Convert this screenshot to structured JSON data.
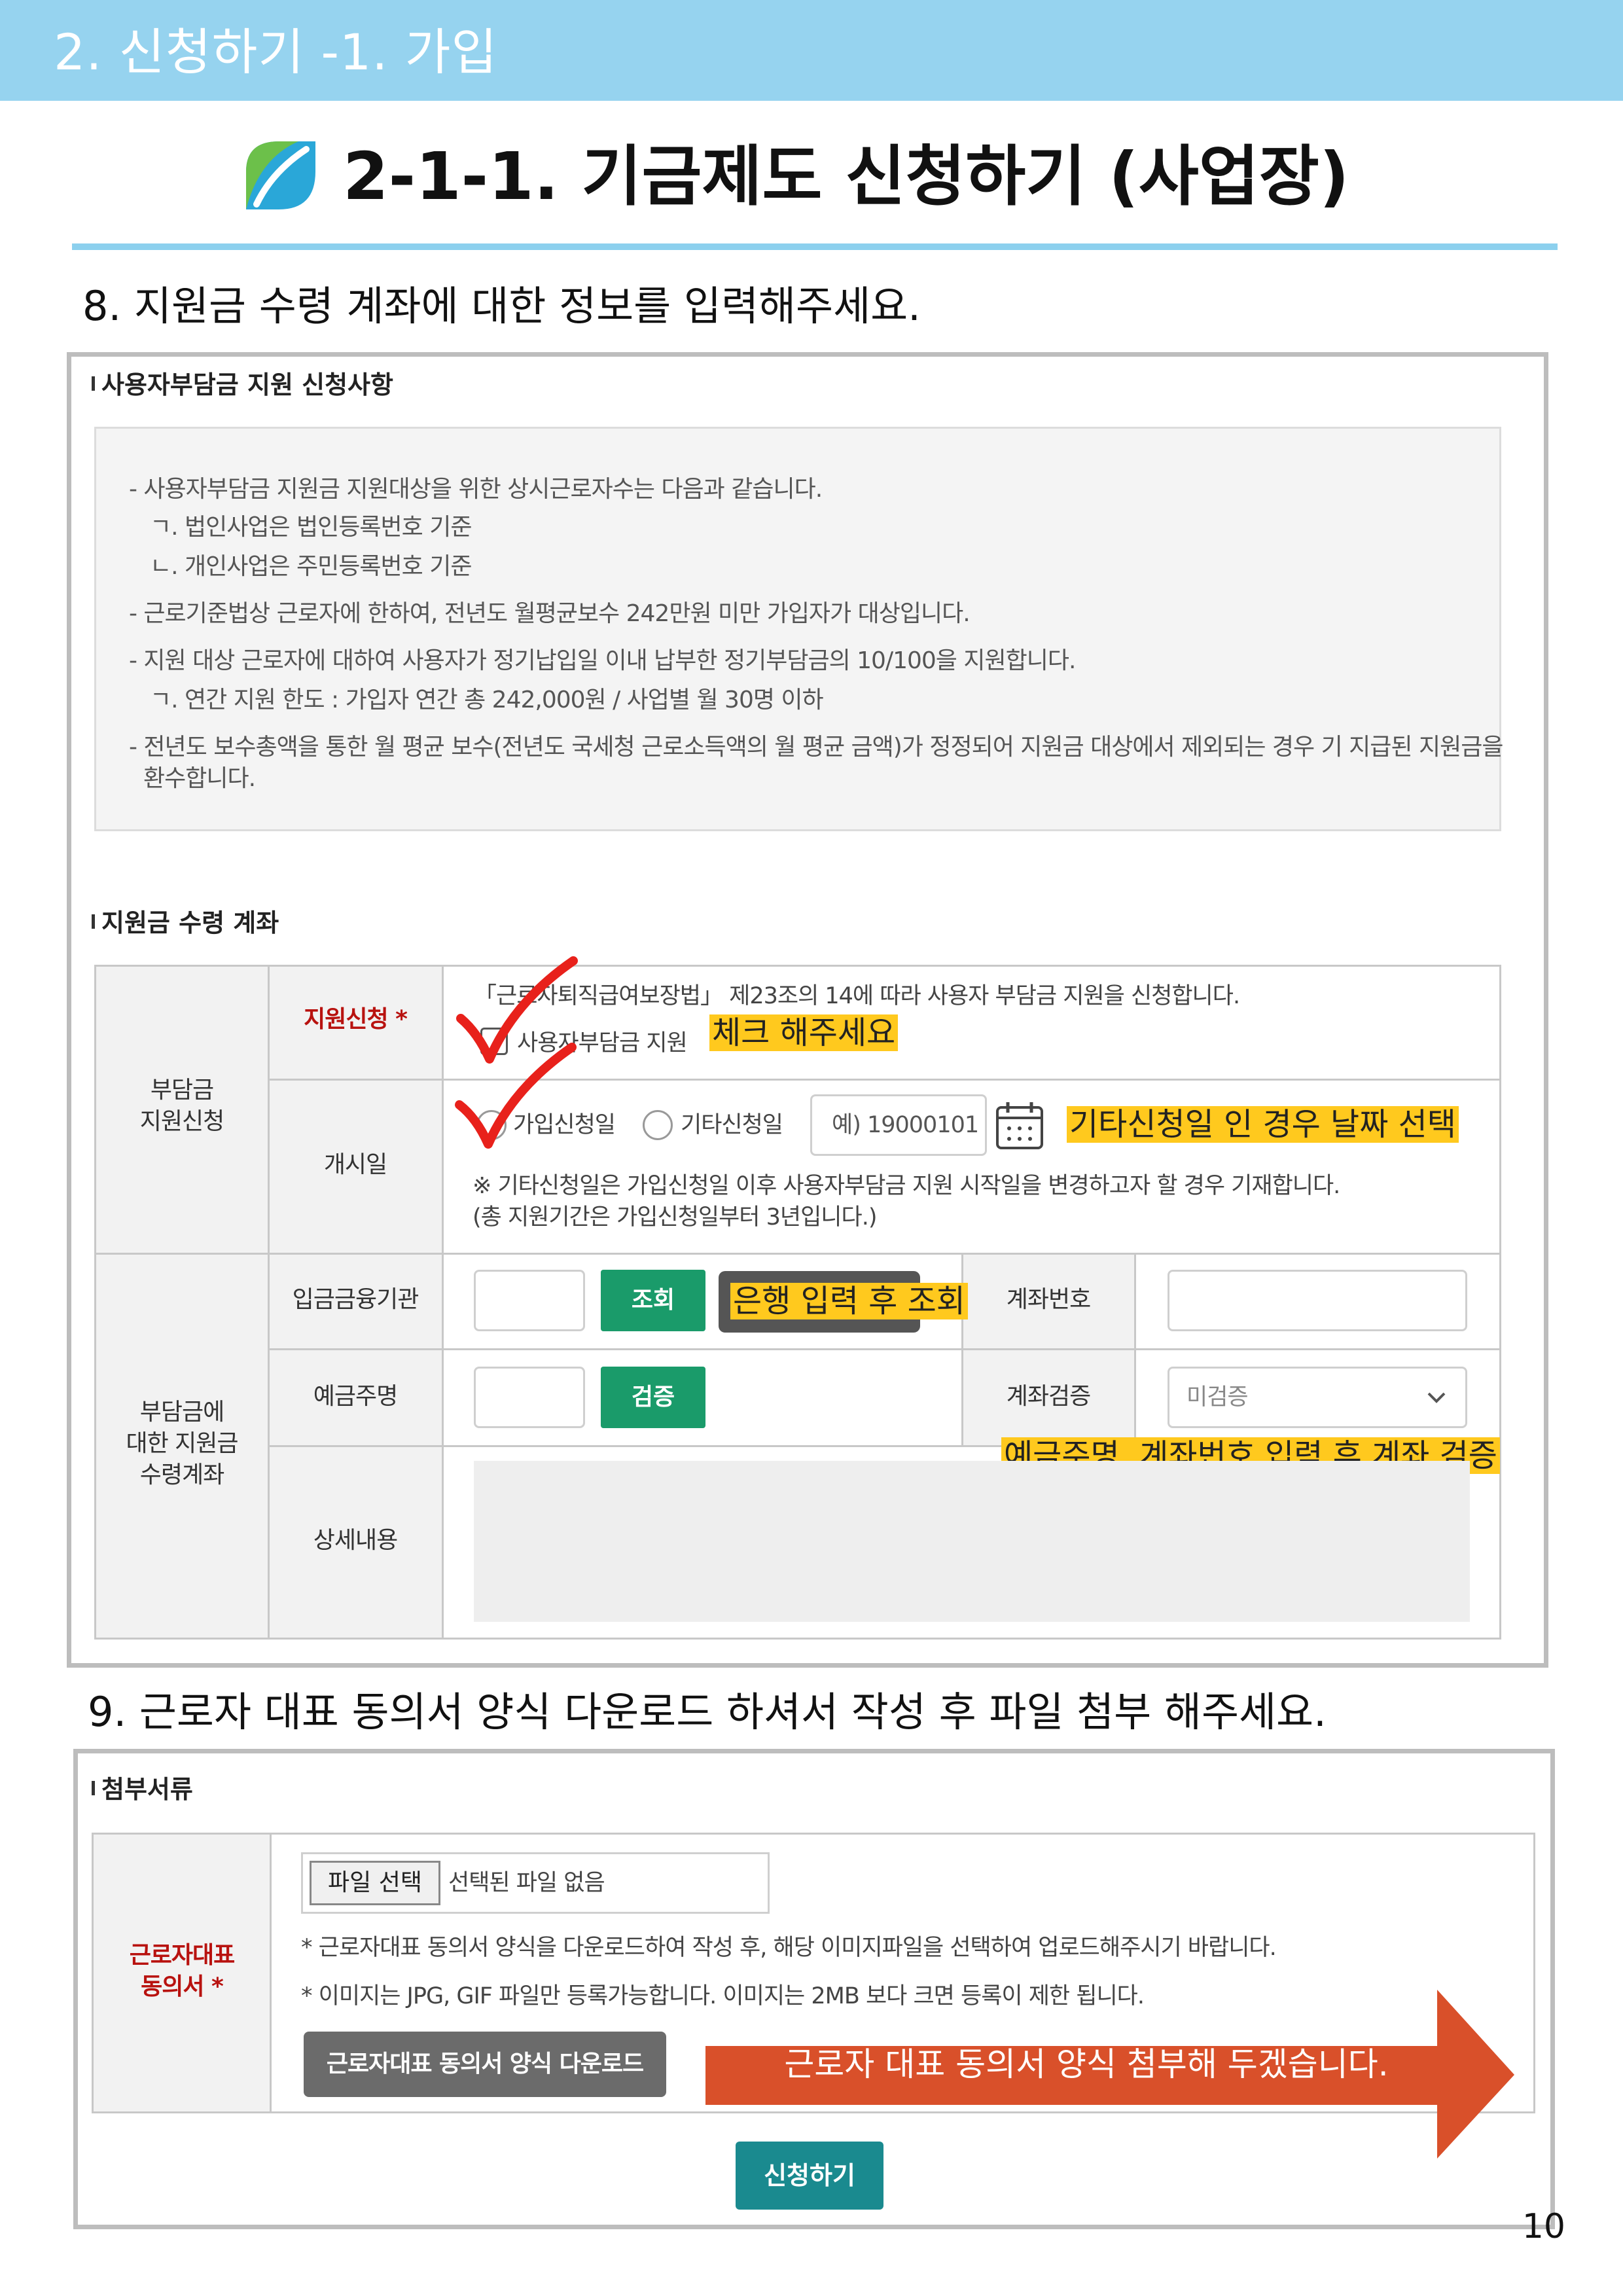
{
  "header": {
    "banner": "2. 신청하기 -1. 가입",
    "title": "2-1-1. 기금제도 신청하기 (사업장)"
  },
  "step8": {
    "instruction": "8. 지원금 수령 계좌에 대한 정보를 입력해주세요.",
    "section1_title": "사용자부담금 지원 신청사항",
    "notice_lines": [
      "- 사용자부담금 지원금 지원대상을 위한 상시근로자수는 다음과 같습니다.",
      "ㄱ. 법인사업은 법인등록번호 기준",
      "ㄴ. 개인사업은 주민등록번호 기준",
      "- 근로기준법상 근로자에 한하여, 전년도 월평균보수 242만원 미만 가입자가 대상입니다.",
      "- 지원 대상 근로자에 대하여 사용자가 정기납입일 이내 납부한 정기부담금의 10/100을 지원합니다.",
      "ㄱ. 연간 지원 한도 : 가입자 연간 총 242,000원 / 사업별 월 30명 이하",
      "- 전년도 보수총액을 통한 월 평균 보수(전년도 국세청 근로소득액의 월 평균 금액)가 정정되어 지원금 대상에서 제외되는 경우 기 지급된 지원금을",
      "환수합니다."
    ],
    "section2_title": "지원금 수령 계좌",
    "group1_header": [
      "부담금",
      "지원신청"
    ],
    "row_apply_label": "지원신청 *",
    "row_apply_text": "「근로자퇴직급여보장법」 제23조의 14에 따라 사용자 부담금 지원을 신청합니다.",
    "row_apply_checkbox_label": "사용자부담금 지원",
    "row_start_label": "개시일",
    "radio_join_date": "가입신청일",
    "radio_other_date": "기타신청일",
    "date_placeholder": "예) 19000101",
    "start_note_1": "※ 기타신청일은 가입신청일 이후 사용자부담금 지원 시작일을 변경하고자 할 경우 기재합니다.",
    "start_note_2": "(총 지원기간은 가입신청일부터 3년입니다.)",
    "group2_header": [
      "부담금에",
      "대한 지원금",
      "수령계좌"
    ],
    "row_bank_label": "입금금융기관",
    "btn_lookup": "조회",
    "row_account_label": "계좌번호",
    "row_holder_label": "예금주명",
    "btn_verify": "검증",
    "row_verify_label": "계좌검증",
    "verify_select_value": "미검증",
    "row_detail_label": "상세내용",
    "callouts": {
      "check": "체크 해주세요",
      "other_date": "기타신청일 인 경우 날짜 선택",
      "bank": "은행 입력 후 조회",
      "verify": "예금주명, 계좌번호 입력 후 계좌 검증"
    }
  },
  "step9": {
    "instruction": "9. 근로자 대표 동의서 양식 다운로드 하셔서 작성 후 파일 첨부 해주세요.",
    "section_title": "첨부서류",
    "row_label": [
      "근로자대표",
      "동의서 *"
    ],
    "file_button": "파일 선택",
    "file_status": "선택된 파일 없음",
    "note_1": "* 근로자대표 동의서 양식을 다운로드하여 작성 후, 해당 이미지파일을 선택하여 업로드해주시기 바랍니다.",
    "note_2": "* 이미지는 JPG, GIF 파일만 등록가능합니다. 이미지는 2MB 보다 크면 등록이 제한 됩니다.",
    "download_button": "근로자대표 동의서 양식 다운로드",
    "arrow_callout": "근로자 대표 동의서 양식 첨부해 두겠습니다.",
    "submit_button": "신청하기"
  },
  "footer": {
    "page_number": "10"
  },
  "colors": {
    "banner": "#96d3ef",
    "highlight": "#ffc91e",
    "green_button": "#1a9b6a",
    "teal_button": "#1a8a8f",
    "arrow": "#d9502a",
    "checkmark": "#e8211b"
  }
}
